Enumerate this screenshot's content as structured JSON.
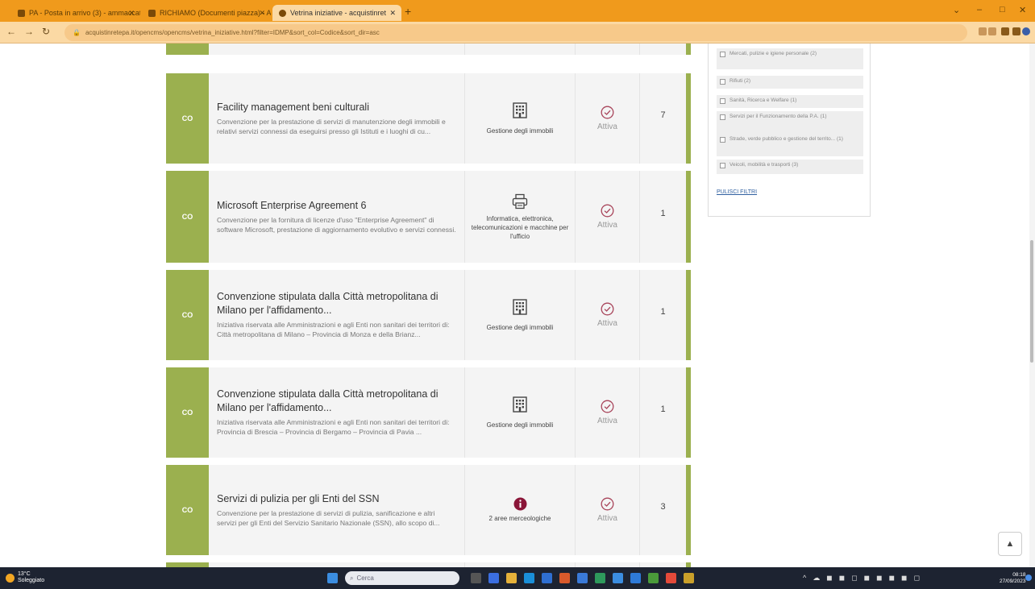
{
  "browser": {
    "tabs": [
      {
        "title": "PA - Posta in arrivo (3) - ammaccato",
        "active": false
      },
      {
        "title": "RICHIAMO (Documenti piazza) - A",
        "active": false
      },
      {
        "title": "Vetrina iniziative - acquistinret",
        "active": true
      }
    ],
    "url": "acquistinretepa.it/opencms/opencms/vetrina_iniziative.html?filter=IDMP&sort_col=Codice&sort_dir=asc"
  },
  "results": [
    {
      "code": "CO",
      "title": "Facility management beni culturali",
      "description": "Convenzione per la prestazione di servizi di manutenzione degli immobili e relativi servizi connessi da eseguirsi presso gli Istituti e i luoghi di cu...",
      "category_icon": "building-icon",
      "category": "Gestione degli immobili",
      "status": "Attiva",
      "lots": "7"
    },
    {
      "code": "CO",
      "title": "Microsoft Enterprise Agreement 6",
      "description": "Convenzione per la fornitura di licenze d'uso \"Enterprise Agreement\" di software Microsoft, prestazione di aggiornamento evolutivo e servizi connessi.",
      "category_icon": "printer-icon",
      "category": "Informatica, elettronica, telecomunicazioni e macchine per l'ufficio",
      "status": "Attiva",
      "lots": "1"
    },
    {
      "code": "CO",
      "title": "Convenzione stipulata dalla Città metropolitana di Milano per l'affidamento...",
      "description": "Iniziativa riservata alle Amministrazioni e agli Enti non sanitari dei territori di: Città metropolitana di Milano – Provincia di Monza e della Brianz...",
      "category_icon": "building-icon",
      "category": "Gestione degli immobili",
      "status": "Attiva",
      "lots": "1"
    },
    {
      "code": "CO",
      "title": "Convenzione stipulata dalla Città metropolitana di Milano per l'affidamento...",
      "description": "Iniziativa riservata alle Amministrazioni e agli Enti non sanitari dei territori di: Provincia di Brescia – Provincia di Bergamo – Provincia di Pavia ...",
      "category_icon": "building-icon",
      "category": "Gestione degli immobili",
      "status": "Attiva",
      "lots": "1"
    },
    {
      "code": "CO",
      "title": "Servizi di pulizia per gli Enti del SSN",
      "description": "Convenzione per la prestazione di servizi di pulizia, sanificazione e altri servizi per gli Enti del Servizio Sanitario Nazionale (SSN), allo scopo di...",
      "category_icon": "info-icon",
      "category": "2 aree merceologiche",
      "status": "Attiva",
      "lots": "3"
    }
  ],
  "filters": {
    "items": [
      "Mercati, pulizie e igiene personale (2)",
      "Rifiuti (2)",
      "Sanità, Ricerca e Welfare (1)",
      "Servizi per il Funzionamento della P.A. (1)",
      "Strade, verde pubblico e gestione del territo... (1)",
      "Veicoli, mobilità e trasporti (3)"
    ],
    "reset_label": "PULISCI FILTRI"
  },
  "taskbar": {
    "weather_temp": "13°C",
    "weather_desc": "Soleggiato",
    "search_placeholder": "Cerca",
    "time": "08:18",
    "date": "27/09/2023"
  },
  "colors": {
    "accent_green": "#9bb04f",
    "chrome_orange": "#f09a1c",
    "taskbar": "#1d2331"
  }
}
